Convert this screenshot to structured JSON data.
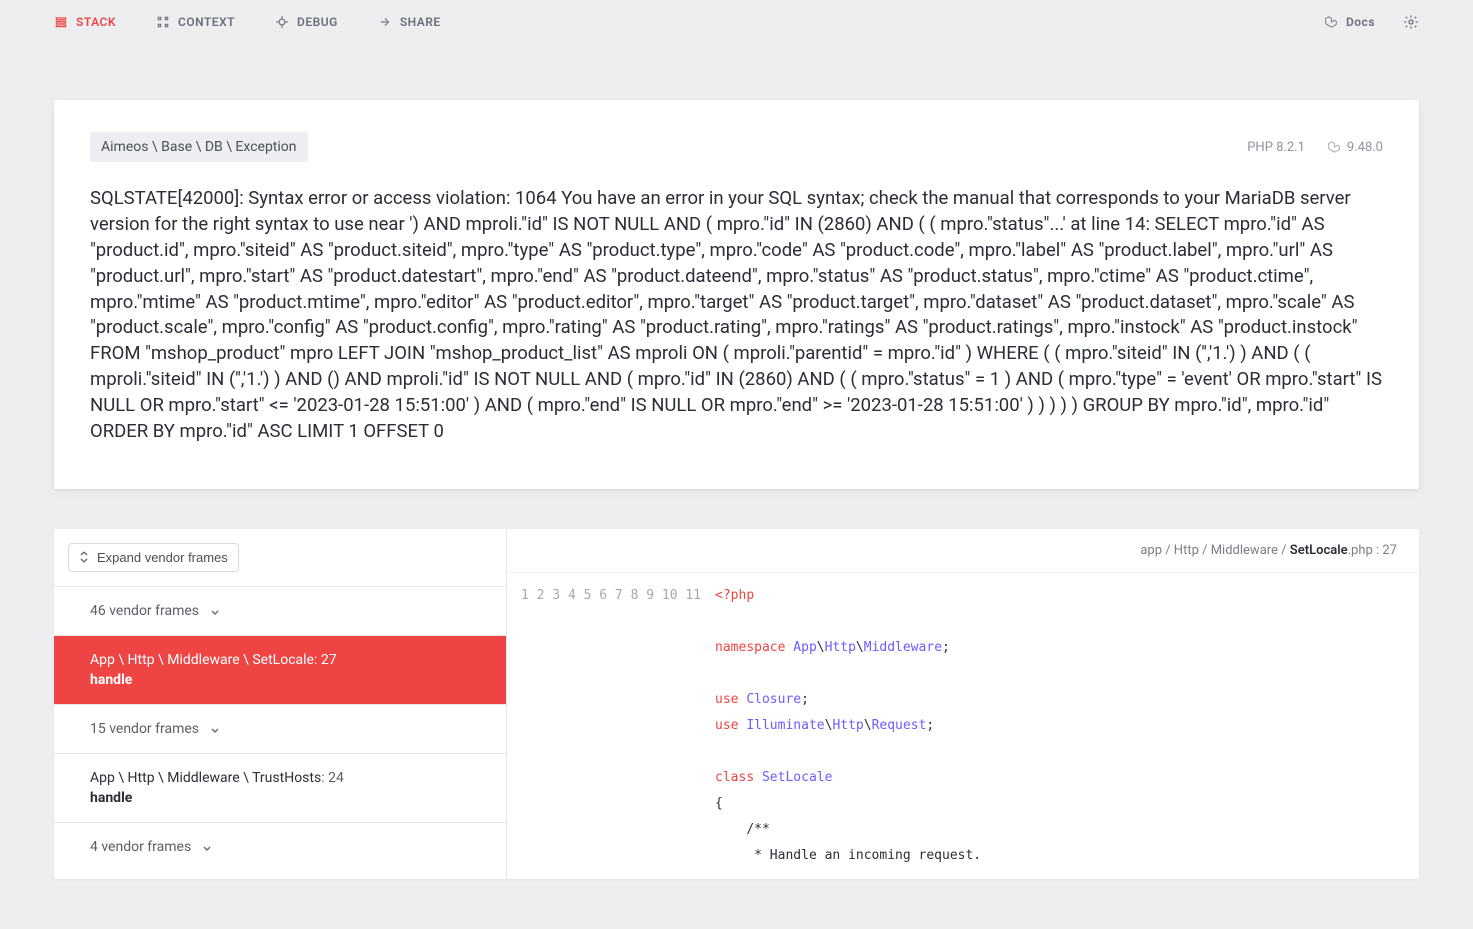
{
  "nav": {
    "stack": "Stack",
    "context": "Context",
    "debug": "Debug",
    "share": "Share",
    "docs": "Docs"
  },
  "header": {
    "breadcrumb": "Aimeos \\ Base \\ DB \\ Exception",
    "php_version": "PHP 8.2.1",
    "laravel_version": "9.48.0"
  },
  "error_message": "SQLSTATE[42000]: Syntax error or access violation: 1064 You have an error in your SQL syntax; check the manual that corresponds to your MariaDB server version for the right syntax to use near ') AND mproli.\"id\" IS NOT NULL AND ( mpro.\"id\" IN (2860) AND ( ( mpro.\"status\"...' at line 14: SELECT mpro.\"id\" AS \"product.id\", mpro.\"siteid\" AS \"product.siteid\", mpro.\"type\" AS \"product.type\", mpro.\"code\" AS \"product.code\", mpro.\"label\" AS \"product.label\", mpro.\"url\" AS \"product.url\", mpro.\"start\" AS \"product.datestart\", mpro.\"end\" AS \"product.dateend\", mpro.\"status\" AS \"product.status\", mpro.\"ctime\" AS \"product.ctime\", mpro.\"mtime\" AS \"product.mtime\", mpro.\"editor\" AS \"product.editor\", mpro.\"target\" AS \"product.target\", mpro.\"dataset\" AS \"product.dataset\", mpro.\"scale\" AS \"product.scale\", mpro.\"config\" AS \"product.config\", mpro.\"rating\" AS \"product.rating\", mpro.\"ratings\" AS \"product.ratings\", mpro.\"instock\" AS \"product.instock\" FROM \"mshop_product\" mpro LEFT JOIN \"mshop_product_list\" AS mproli ON ( mproli.\"parentid\" = mpro.\"id\" ) WHERE ( ( mpro.\"siteid\" IN ('','1.') ) AND ( ( mproli.\"siteid\" IN ('','1.') ) AND () AND mproli.\"id\" IS NOT NULL AND ( mpro.\"id\" IN (2860) AND ( ( mpro.\"status\" = 1 ) AND ( mpro.\"type\" = 'event' OR mpro.\"start\" IS NULL OR mpro.\"start\" <= '2023-01-28 15:51:00' ) AND ( mpro.\"end\" IS NULL OR mpro.\"end\" >= '2023-01-28 15:51:00' ) ) ) ) ) GROUP BY mpro.\"id\", mpro.\"id\" ORDER BY mpro.\"id\" ASC LIMIT 1 OFFSET 0",
  "frames": {
    "expand_label": "Expand vendor frames",
    "group1_label": "46 vendor frames",
    "active": {
      "class": "App \\ Http \\ Middleware \\ SetLocale",
      "line": ": 27",
      "fn": "handle"
    },
    "group2_label": "15 vendor frames",
    "row2": {
      "class": "App \\ Http \\ Middleware \\ TrustHosts",
      "line": ": 24",
      "fn": "handle"
    },
    "group3_label": "4 vendor frames"
  },
  "file": {
    "prefix": "app / Http / Middleware / ",
    "name": "SetLocale",
    "ext": ".php",
    "line": " : 27"
  },
  "code": {
    "line_numbers": "1\n2\n3\n4\n5\n6\n7\n8\n9\n10\n11"
  }
}
